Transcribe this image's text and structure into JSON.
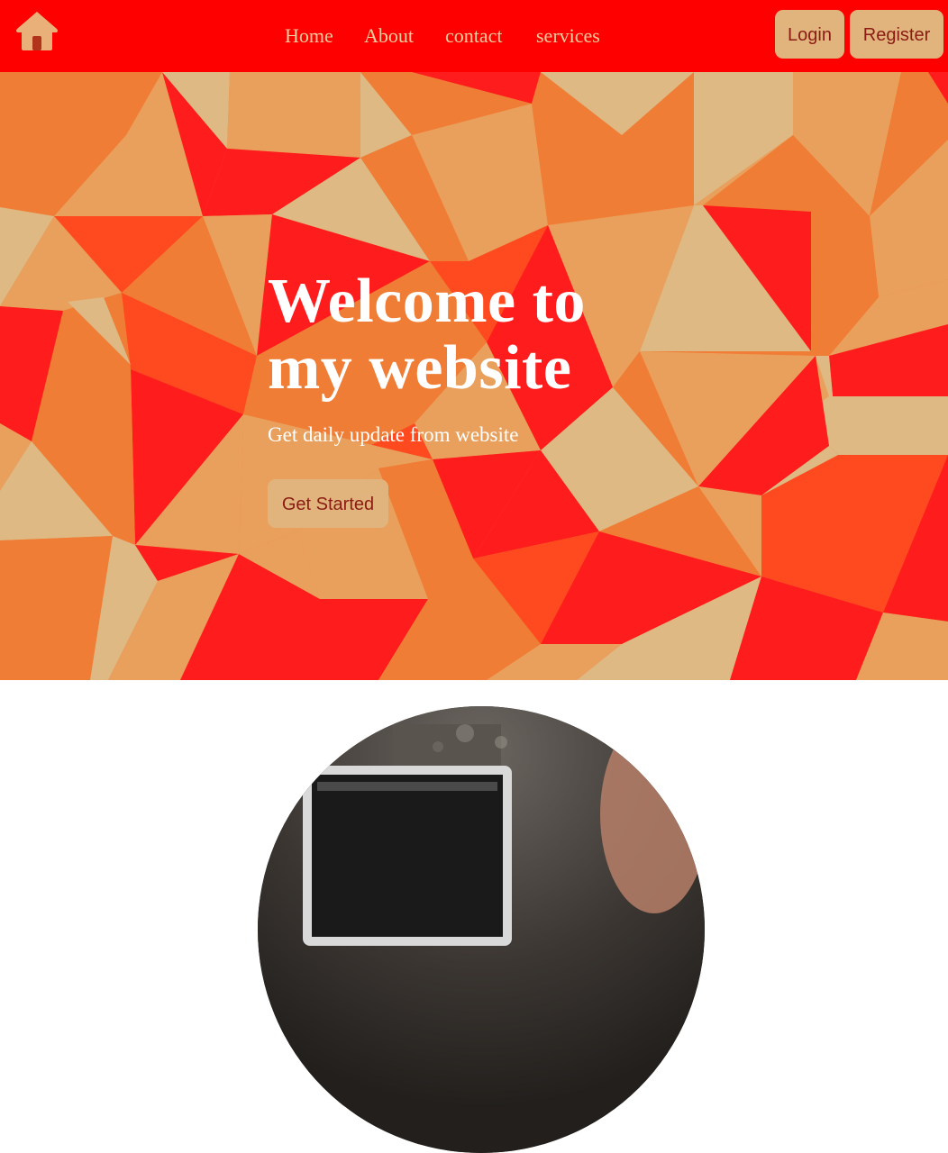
{
  "nav": {
    "logo_icon": "home-icon",
    "links": [
      "Home",
      "About",
      "contact",
      "services"
    ],
    "login_label": "Login",
    "register_label": "Register"
  },
  "hero": {
    "title_line1": "Welcome to",
    "title_line2": "my website",
    "subtitle": "Get daily update from website",
    "cta_label": "Get Started"
  },
  "colors": {
    "navbar": "#ff0000",
    "nav_text": "#f2cfa0",
    "button_bg": "#e2b47d",
    "button_text": "#8a1c13",
    "hero_red": "#ff1c1c",
    "hero_orange": "#f07d35",
    "hero_peach": "#e9a05c",
    "hero_tan": "#deb984"
  }
}
